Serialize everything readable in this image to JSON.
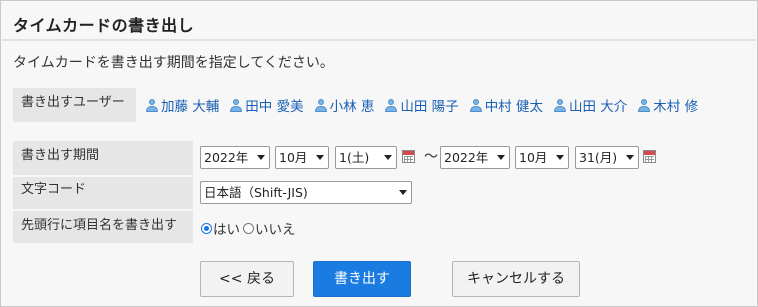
{
  "page": {
    "title": "タイムカードの書き出し",
    "description": "タイムカードを書き出す期間を指定してください。"
  },
  "users": {
    "label": "書き出すユーザー",
    "items": [
      "加藤 大輔",
      "田中 愛美",
      "小林 恵",
      "山田 陽子",
      "中村 健太",
      "山田 大介",
      "木村 修"
    ]
  },
  "period": {
    "label": "書き出す期間",
    "start": {
      "year": "2022年",
      "month": "10月",
      "day": "1(土)"
    },
    "separator": "〜",
    "end": {
      "year": "2022年",
      "month": "10月",
      "day": "31(月)"
    }
  },
  "encoding": {
    "label": "文字コード",
    "selected": "日本語（Shift-JIS)"
  },
  "header_row": {
    "label": "先頭行に項目名を書き出す",
    "options": [
      "はい",
      "いいえ"
    ],
    "selected": "はい"
  },
  "buttons": {
    "back": "<< 戻る",
    "export": "書き出す",
    "cancel": "キャンセルする"
  },
  "colors": {
    "link": "#1a5fb4",
    "primary_button": "#1a7be0",
    "label_bg": "#e6e6e6"
  }
}
